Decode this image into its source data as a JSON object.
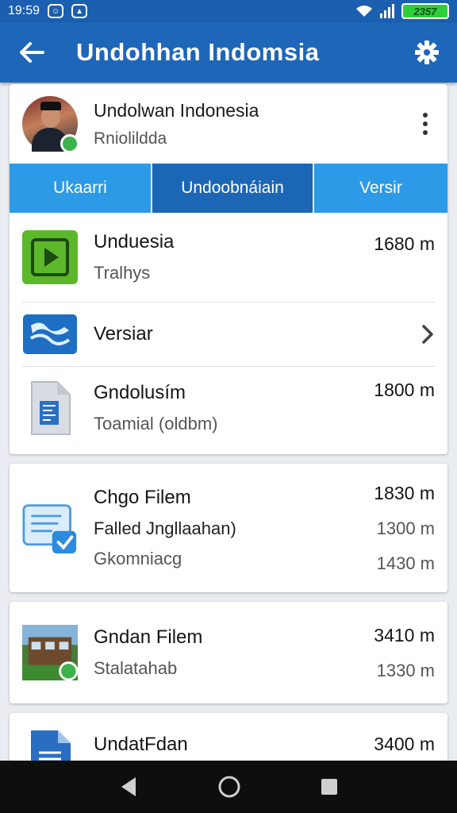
{
  "status_bar": {
    "time": "19:59",
    "battery": "2357",
    "icons": [
      "notification-icon",
      "notification-icon",
      "wifi-icon",
      "signal-icon",
      "battery-icon"
    ]
  },
  "app_bar": {
    "title": "Undohhan Indomsia",
    "back_icon": "back-arrow-icon",
    "settings_icon": "gear-icon"
  },
  "profile": {
    "name": "Undolwan Indonesia",
    "subtitle": "Rniolildda",
    "more_icon": "more-vert-icon"
  },
  "tabs": [
    {
      "label": "Ukaarri",
      "active": false
    },
    {
      "label": "Undoobnáiain",
      "active": true
    },
    {
      "label": "Versir",
      "active": false
    }
  ],
  "section1": {
    "rows": [
      {
        "title": "Unduesia",
        "subtitle": "Tralhys",
        "value": "1680 m",
        "icon": "video-play-icon"
      },
      {
        "title": "Versiar",
        "icon": "map-icon",
        "trailing_icon": "chevron-right-icon"
      },
      {
        "title": "Gndolusím",
        "subtitle": "Toamial (oldbm)",
        "value": "1800 m",
        "icon": "document-icon"
      }
    ]
  },
  "section2": {
    "title": "Chgo Filem",
    "line2": "Falled Jngllaahan)",
    "line3": "Gkomniacg",
    "values": [
      "1830 m",
      "1300 m",
      "1430 m"
    ],
    "icon": "document-edit-icon"
  },
  "section3": {
    "title": "Gndan Filem",
    "subtitle": "Stalatahab",
    "value": "3410 m",
    "value2": "1330 m",
    "icon": "building-thumbnail-icon"
  },
  "section4": {
    "title": "UndatFdan",
    "value": "3400 m",
    "icon": "docs-icon"
  },
  "nav_bar": {
    "back": "nav-back-icon",
    "home": "nav-home-icon",
    "recents": "nav-recents-icon"
  },
  "colors": {
    "app_bar": "#1e66b8",
    "tab": "#2c9ae6",
    "tab_active": "#1c66b6",
    "accent_green": "#5cb82a"
  }
}
